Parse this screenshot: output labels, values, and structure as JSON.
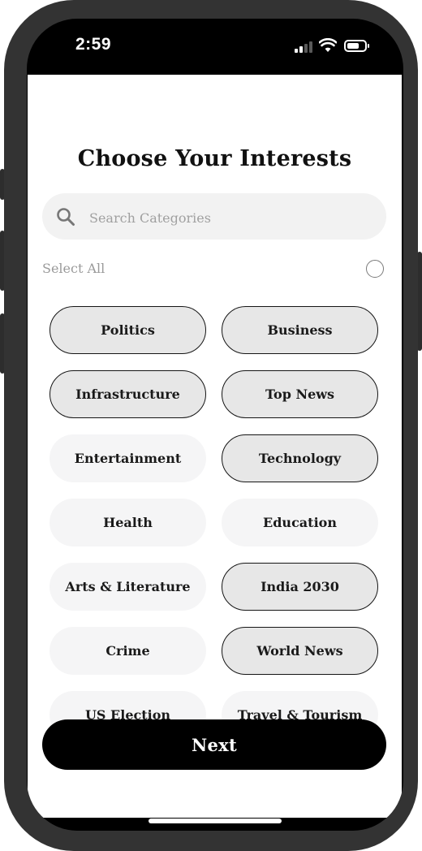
{
  "status_bar": {
    "time": "2:59"
  },
  "page": {
    "title": "Choose Your Interests"
  },
  "search": {
    "placeholder": "Search Categories",
    "value": ""
  },
  "select_all": {
    "label": "Select All",
    "checked": false
  },
  "categories": [
    {
      "label": "Politics",
      "selected": true
    },
    {
      "label": "Business",
      "selected": true
    },
    {
      "label": "Infrastructure",
      "selected": true
    },
    {
      "label": "Top News",
      "selected": true
    },
    {
      "label": "Entertainment",
      "selected": false
    },
    {
      "label": "Technology",
      "selected": true
    },
    {
      "label": "Health",
      "selected": false
    },
    {
      "label": "Education",
      "selected": false
    },
    {
      "label": "Arts & Literature",
      "selected": false
    },
    {
      "label": "India 2030",
      "selected": true
    },
    {
      "label": "Crime",
      "selected": false
    },
    {
      "label": "World News",
      "selected": true
    },
    {
      "label": "US Election",
      "selected": false
    },
    {
      "label": "Travel & Tourism",
      "selected": false
    }
  ],
  "actions": {
    "next_label": "Next"
  },
  "colors": {
    "primary": "#000000",
    "chip_selected_bg": "#e7e7e7",
    "chip_unselected_bg": "#f5f5f6",
    "search_bg": "#f2f2f2"
  }
}
